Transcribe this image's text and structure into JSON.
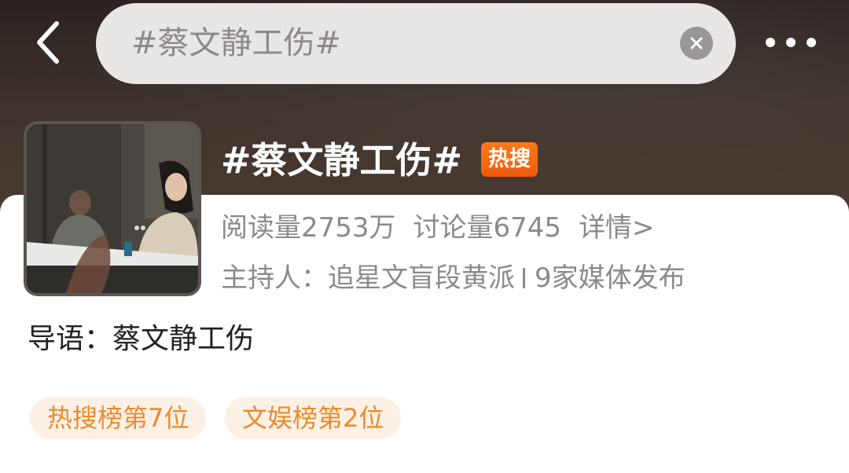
{
  "search": {
    "query": "#蔡文静工伤#"
  },
  "topic": {
    "title": "#蔡文静工伤#",
    "badge": "热搜",
    "reads_label": "阅读量2753万",
    "discussions_label": "讨论量6745",
    "details_label": "详情>",
    "host_label": "主持人：追星文盲段黄派",
    "media_label": "9家媒体发布",
    "intro": "导语：蔡文静工伤"
  },
  "tags": [
    {
      "label": "热搜榜第7位"
    },
    {
      "label": "文娱榜第2位"
    }
  ],
  "icons": {
    "back": "chevron-left-icon",
    "clear": "close-icon",
    "more": "more-dots-icon"
  },
  "colors": {
    "header_background": "#3a2f2a",
    "hot_badge": "#f26a10",
    "tag_text": "#ec8a2c",
    "tag_background": "#fdf1e6"
  }
}
